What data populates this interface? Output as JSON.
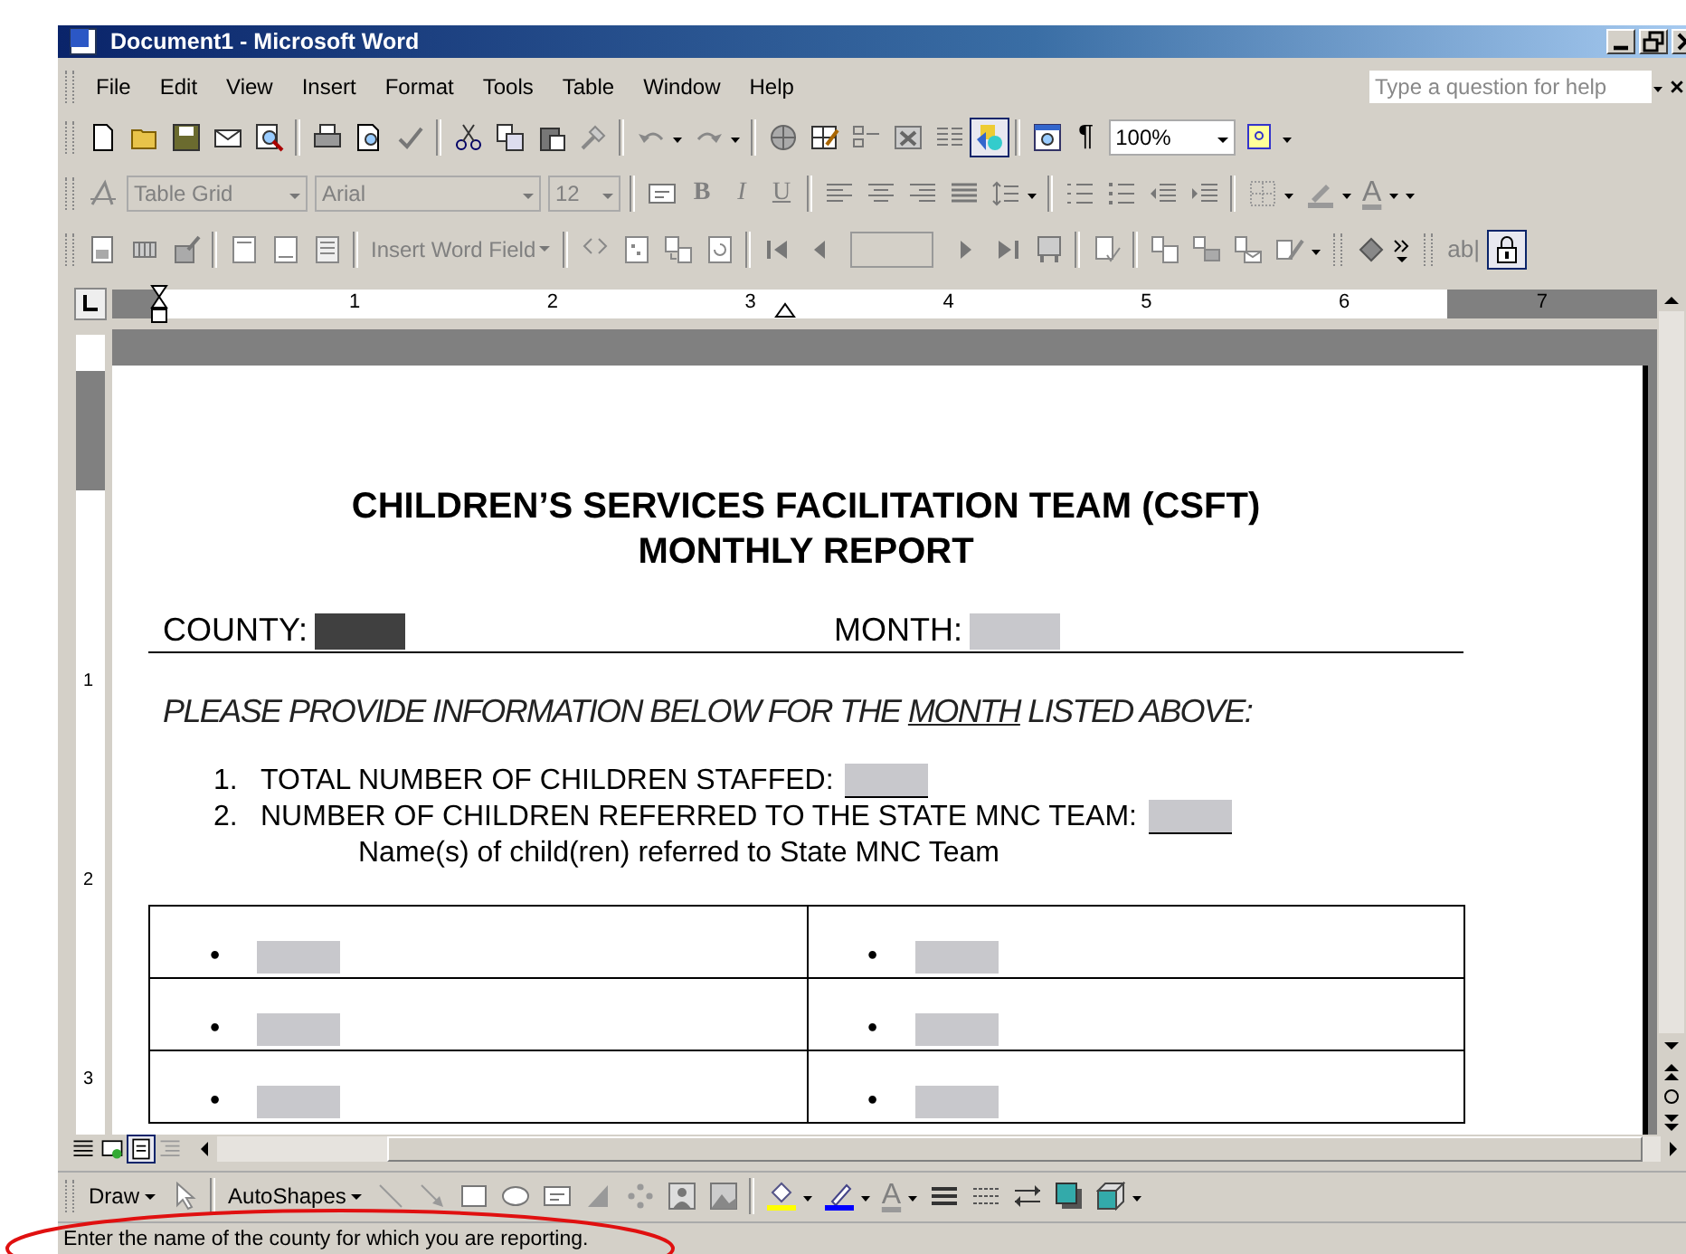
{
  "window": {
    "title": "Document1 - Microsoft Word"
  },
  "menu": [
    "File",
    "Edit",
    "View",
    "Insert",
    "Format",
    "Tools",
    "Table",
    "Window",
    "Help"
  ],
  "help_box": {
    "placeholder": "Type a question for help"
  },
  "standard_toolbar": {
    "drawing_pressed": true,
    "pilcrow": "¶",
    "zoom": "100%"
  },
  "formatting_toolbar": {
    "style": "Table Grid",
    "font": "Arial",
    "size": "12",
    "bold": "B",
    "italic": "I",
    "underline": "U",
    "font_color": "A"
  },
  "forms_toolbar": {
    "insert_field": "Insert Word Field",
    "text_field": "ab|",
    "protect_pressed": true
  },
  "ruler": {
    "numbers": [
      "1",
      "2",
      "3",
      "4",
      "5",
      "6",
      "7"
    ]
  },
  "vertical_ruler": {
    "numbers": [
      "1",
      "2",
      "3"
    ]
  },
  "document": {
    "title_lines": [
      "CHILDREN’S SERVICES FACILITATION TEAM (CSFT)",
      "MONTHLY REPORT"
    ],
    "header_fields": [
      {
        "label": "COUNTY:",
        "selected": true
      },
      {
        "label": "MONTH:",
        "selected": false
      }
    ],
    "instruction": {
      "before": "PLEASE PROVIDE INFORMATION BELOW FOR THE ",
      "underlined": "MONTH",
      "after": " LISTED ABOVE:"
    },
    "items": [
      {
        "number": "1.",
        "text": "TOTAL NUMBER OF CHILDREN STAFFED:"
      },
      {
        "number": "2.",
        "text": "NUMBER OF CHILDREN REFERRED TO THE STATE MNC TEAM:"
      }
    ],
    "note": "Name(s) of child(ren) referred to State MNC Team",
    "table_rows": [
      [
        "•",
        "•"
      ],
      [
        "•",
        "•"
      ],
      [
        "•",
        "•"
      ]
    ]
  },
  "view_buttons": [
    {
      "selected": false
    },
    {
      "selected": false
    },
    {
      "selected": true
    },
    {
      "selected": false
    }
  ],
  "drawing_toolbar": {
    "draw": "Draw",
    "autoshapes": "AutoShapes",
    "font_color": "A"
  },
  "status_bar": {
    "text": "Enter the name of the county for which you are reporting."
  }
}
